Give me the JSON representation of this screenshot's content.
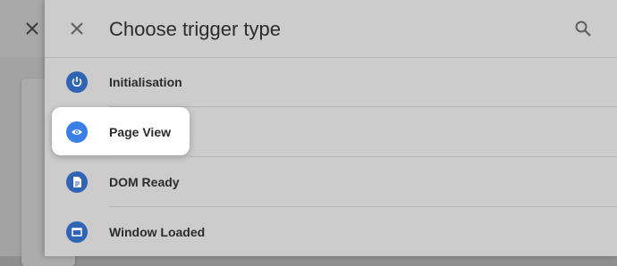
{
  "dialog": {
    "title": "Choose trigger type"
  },
  "trigger_types": [
    {
      "label": "Initialisation",
      "icon": "power-icon"
    },
    {
      "label": "Page View",
      "icon": "eye-icon",
      "highlighted": true
    },
    {
      "label": "DOM Ready",
      "icon": "document-icon"
    },
    {
      "label": "Window Loaded",
      "icon": "window-icon"
    }
  ],
  "colors": {
    "icon_blue": "#2f63b3",
    "highlight_icon_blue": "#3c7ee8"
  }
}
